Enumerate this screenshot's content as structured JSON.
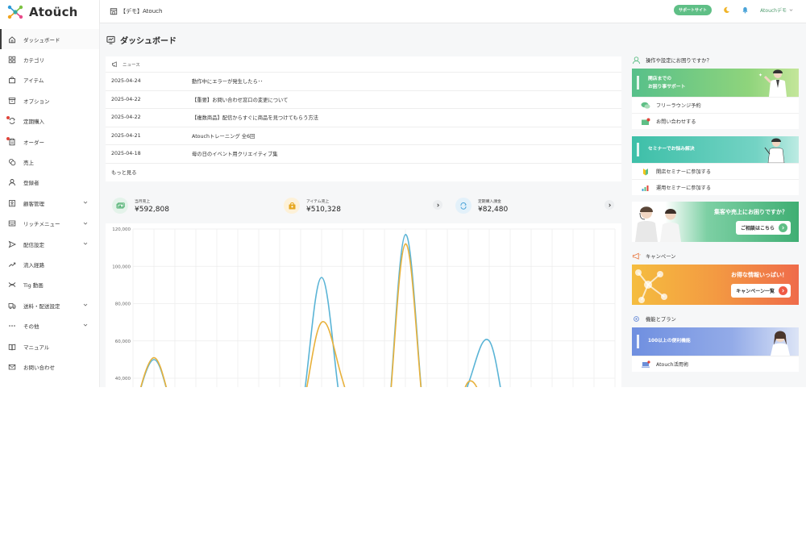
{
  "brand": {
    "name": "Atoüch"
  },
  "header": {
    "store_name": "【デモ】Atouch",
    "support_label": "サポートサイト",
    "user_name": "Atouchデモ"
  },
  "sidebar": {
    "items": [
      {
        "label": "ダッシュボード",
        "icon": "home-icon",
        "active": true
      },
      {
        "label": "カテゴリ",
        "icon": "grid-icon"
      },
      {
        "label": "アイテム",
        "icon": "bag-icon"
      },
      {
        "label": "オプション",
        "icon": "box-icon"
      },
      {
        "label": "定期購入",
        "icon": "repeat-icon",
        "badge": true
      },
      {
        "label": "オーダー",
        "icon": "clipboard-icon",
        "badge": true
      },
      {
        "label": "売上",
        "icon": "coins-icon"
      },
      {
        "label": "登録者",
        "icon": "user-icon"
      },
      {
        "label": "顧客管理",
        "icon": "id-icon",
        "expandable": true
      },
      {
        "label": "リッチメニュー",
        "icon": "menu-icon",
        "expandable": true
      },
      {
        "label": "配信設定",
        "icon": "send-icon",
        "expandable": true
      },
      {
        "label": "流入経路",
        "icon": "trend-icon"
      },
      {
        "label": "Tig 動画",
        "icon": "tig-icon"
      },
      {
        "label": "送料・配送設定",
        "icon": "truck-icon",
        "expandable": true
      },
      {
        "label": "その他",
        "icon": "more-icon",
        "expandable": true
      },
      {
        "label": "マニュアル",
        "icon": "book-icon"
      },
      {
        "label": "お問い合わせ",
        "icon": "mail-icon"
      }
    ]
  },
  "page": {
    "title": "ダッシュボード"
  },
  "news": {
    "heading": "ニュース",
    "rows": [
      {
        "date": "2025-04-24",
        "title": "動作中にエラーが発生したら･･"
      },
      {
        "date": "2025-04-22",
        "title": "【重要】お問い合わせ窓口の変更について"
      },
      {
        "date": "2025-04-22",
        "title": "【複数商品】配信からすぐに商品を見つけてもらう方法"
      },
      {
        "date": "2025-04-21",
        "title": "Atouchトレーニング 全6回"
      },
      {
        "date": "2025-04-18",
        "title": "母の日のイベント用クリエイティブ集"
      }
    ],
    "more_label": "もっと見る"
  },
  "stats": [
    {
      "label": "当月売上",
      "value": "¥592,808",
      "icon": "money-icon",
      "color": "#e4f3ea",
      "stroke": "#4caf6e",
      "arrow": false
    },
    {
      "label": "アイテム売上",
      "value": "¥510,328",
      "icon": "bag-icon",
      "color": "#fdf1d8",
      "stroke": "#e6a820",
      "arrow": true
    },
    {
      "label": "定期購入課金",
      "value": "¥82,480",
      "icon": "sync-icon",
      "color": "#e3f1fa",
      "stroke": "#4aa3d8",
      "arrow": true
    }
  ],
  "chart_data": {
    "type": "line",
    "ylim": [
      30000,
      120000
    ],
    "yticks": [
      120000,
      100000,
      80000,
      60000,
      40000
    ],
    "ytick_labels": [
      "120,000",
      "100,000",
      "80,000",
      "60,000",
      "40,000"
    ],
    "x": [
      0,
      1,
      2,
      3,
      4,
      5,
      6,
      7,
      8,
      9,
      10,
      11,
      12,
      13,
      14,
      15,
      16,
      17,
      18,
      19,
      20,
      21,
      22,
      23
    ],
    "series": [
      {
        "color": "#5ab4d6",
        "values": [
          20000,
          50000,
          20000,
          0,
          0,
          0,
          0,
          0,
          20000,
          94000,
          20000,
          0,
          0,
          117000,
          10000,
          0,
          37000,
          60000,
          10000,
          0,
          0,
          0,
          0,
          0
        ]
      },
      {
        "color": "#e8b13b",
        "values": [
          20000,
          51000,
          20000,
          0,
          0,
          0,
          0,
          0,
          20000,
          70000,
          39000,
          0,
          0,
          112000,
          10000,
          0,
          38000,
          20000,
          0,
          0,
          0,
          0,
          0,
          0
        ]
      }
    ]
  },
  "right": {
    "help_title": "操作や設定にお困りですか？",
    "help_banner": [
      "開店までの",
      "お困り事サポート"
    ],
    "help_rows": [
      "フリーラウンジ予約",
      "お問い合わせする"
    ],
    "seminar_banner": "セミナーでお悩み解決",
    "seminar_rows": [
      "開店セミナーに参加する",
      "運用セミナーに参加する"
    ],
    "consult_text": "集客や売上にお困りですか？",
    "consult_button": "ご相談はこちら",
    "campaign_title": "キャンペーン",
    "campaign_text": "お得な情報いっぱい！",
    "campaign_button": "キャンペーン一覧",
    "plan_title": "機能とプラン",
    "plan_banner": "100以上の便利機能",
    "plan_row": "Atouch活用術"
  }
}
